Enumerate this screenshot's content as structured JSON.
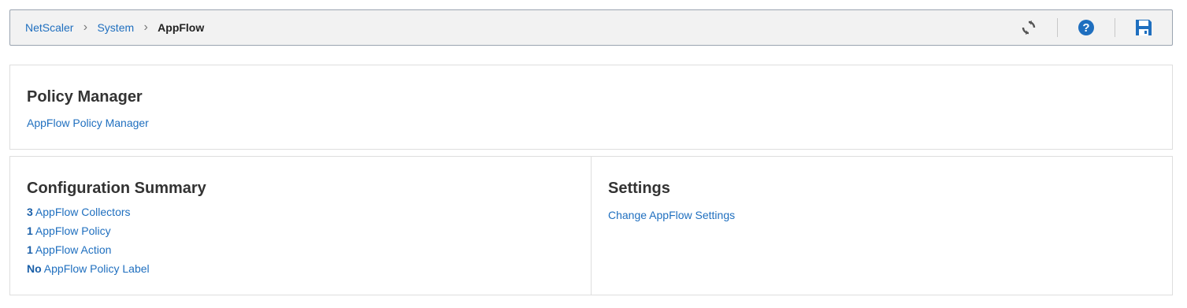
{
  "breadcrumb": {
    "items": [
      "NetScaler",
      "System"
    ],
    "current": "AppFlow"
  },
  "toolbar": {
    "refresh_icon": "refresh-icon",
    "help_icon": "help-icon",
    "save_icon": "save-icon",
    "accent": "#1f6fbf"
  },
  "policy_manager": {
    "title": "Policy Manager",
    "link": "AppFlow Policy Manager"
  },
  "config_summary": {
    "title": "Configuration Summary",
    "items": [
      {
        "count": "3",
        "label": "AppFlow Collectors"
      },
      {
        "count": "1",
        "label": "AppFlow Policy"
      },
      {
        "count": "1",
        "label": "AppFlow Action"
      },
      {
        "count": "No",
        "label": "AppFlow Policy Label"
      }
    ]
  },
  "settings": {
    "title": "Settings",
    "link": "Change AppFlow Settings"
  }
}
